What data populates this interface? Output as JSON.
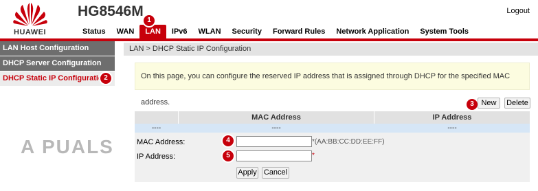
{
  "header": {
    "brand": "HUAWEI",
    "model": "HG8546M",
    "logout": "Logout",
    "nav": [
      "Status",
      "WAN",
      "LAN",
      "IPv6",
      "WLAN",
      "Security",
      "Forward Rules",
      "Network Application",
      "System Tools"
    ],
    "active_nav": "LAN",
    "colors": {
      "accent": "#c7000b"
    }
  },
  "sidebar": {
    "items": [
      {
        "label": "LAN Host Configuration"
      },
      {
        "label": "DHCP Server Configuration"
      },
      {
        "label": "DHCP Static IP Configuration"
      }
    ]
  },
  "main": {
    "breadcrumb": "LAN > DHCP Static IP Configuration",
    "info": "On this page, you can configure the reserved IP address that is assigned through DHCP for the specified MAC address.",
    "buttons": {
      "new": "New",
      "delete": "Delete"
    },
    "table": {
      "headers": [
        "",
        "MAC Address",
        "IP Address"
      ],
      "row": [
        "----",
        "----",
        "----"
      ]
    },
    "form": {
      "mac_label": "MAC Address:",
      "mac_hint": "*(AA:BB:CC:DD:EE:FF)",
      "ip_label": "IP Address:",
      "ip_star": "*",
      "apply": "Apply",
      "cancel": "Cancel"
    }
  },
  "annotations": [
    "1",
    "2",
    "3",
    "4",
    "5"
  ],
  "watermark": "A  PUALS"
}
